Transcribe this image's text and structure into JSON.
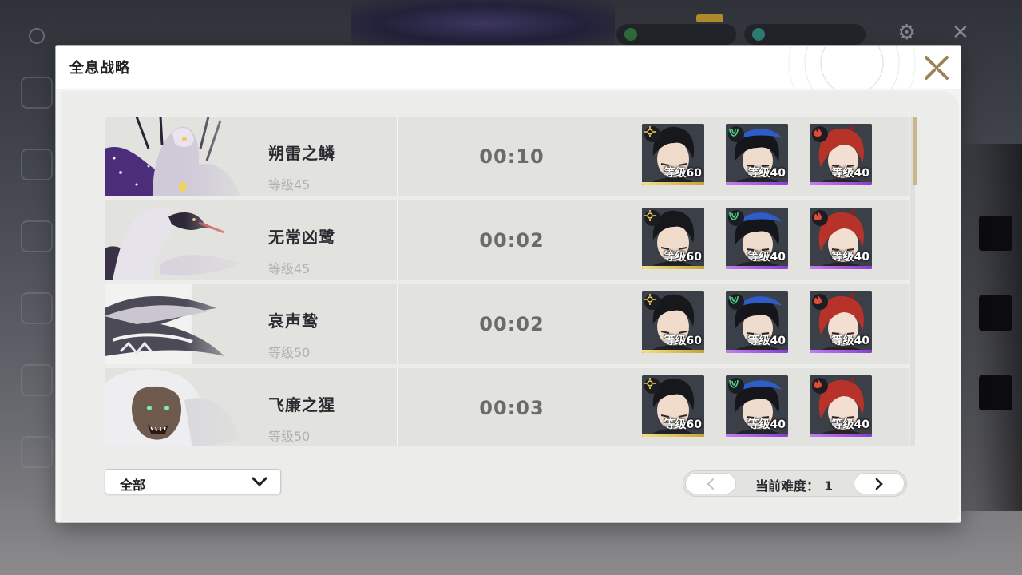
{
  "panel": {
    "title": "全息战略"
  },
  "bosses": [
    {
      "name": "朔雷之鳞",
      "level": "等级45",
      "time": "00:10",
      "team": [
        {
          "element_icon": "spectro-icon",
          "element_color": "#f1d35a",
          "level": "等级60",
          "rarity": "gold"
        },
        {
          "element_icon": "aero-icon",
          "element_color": "#4fd08a",
          "level": "等级40",
          "rarity": "purple"
        },
        {
          "element_icon": "fusion-icon",
          "element_color": "#e24b36",
          "level": "等级40",
          "rarity": "purple"
        }
      ]
    },
    {
      "name": "无常凶鹭",
      "level": "等级45",
      "time": "00:02",
      "team": [
        {
          "element_icon": "spectro-icon",
          "element_color": "#f1d35a",
          "level": "等级60",
          "rarity": "gold"
        },
        {
          "element_icon": "aero-icon",
          "element_color": "#4fd08a",
          "level": "等级40",
          "rarity": "purple"
        },
        {
          "element_icon": "fusion-icon",
          "element_color": "#e24b36",
          "level": "等级40",
          "rarity": "purple"
        }
      ]
    },
    {
      "name": "哀声鸷",
      "level": "等级50",
      "time": "00:02",
      "team": [
        {
          "element_icon": "spectro-icon",
          "element_color": "#f1d35a",
          "level": "等级60",
          "rarity": "gold"
        },
        {
          "element_icon": "aero-icon",
          "element_color": "#4fd08a",
          "level": "等级40",
          "rarity": "purple"
        },
        {
          "element_icon": "fusion-icon",
          "element_color": "#e24b36",
          "level": "等级40",
          "rarity": "purple"
        }
      ]
    },
    {
      "name": "飞廉之猩",
      "level": "等级50",
      "time": "00:03",
      "team": [
        {
          "element_icon": "spectro-icon",
          "element_color": "#f1d35a",
          "level": "等级60",
          "rarity": "gold"
        },
        {
          "element_icon": "aero-icon",
          "element_color": "#4fd08a",
          "level": "等级40",
          "rarity": "purple"
        },
        {
          "element_icon": "fusion-icon",
          "element_color": "#e24b36",
          "level": "等级40",
          "rarity": "purple"
        }
      ]
    }
  ],
  "filter": {
    "selected": "全部"
  },
  "pager": {
    "label": "当前难度：",
    "value": "1"
  },
  "colors": {
    "panel_bg": "#f3f3f1",
    "row_bg": "#e2e2df",
    "time_text": "#6b6b68",
    "rarity_gold": "#e8cf6a",
    "rarity_purple": "#a95fe0",
    "scroll_thumb": "#c9b68a"
  }
}
